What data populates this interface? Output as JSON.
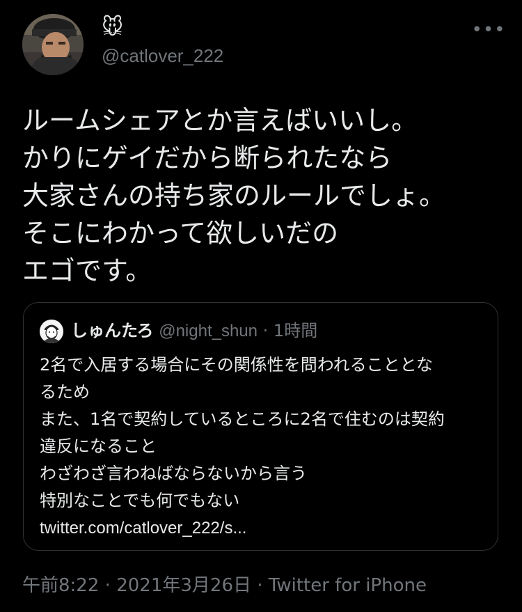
{
  "author": {
    "display_name": "🐭",
    "handle": "@catlover_222"
  },
  "more_label": "•••",
  "tweet": {
    "lines": [
      "ルームシェアとか言えばいいし。",
      "かりにゲイだから断られたなら",
      "大家さんの持ち家のルールでしょ。",
      "そこにわかって欲しいだの",
      "エゴです。"
    ]
  },
  "quote": {
    "name": "しゅんたろ",
    "handle": "@night_shun",
    "separator": "·",
    "time": "1時間",
    "lines": [
      "2名で入居する場合にその関係性を問われることとな",
      "るため",
      "また、1名で契約しているところに2名で住むのは契約",
      "違反になること",
      "わざわざ言わねばならないから言う",
      "特別なことでも何でもない",
      "twitter.com/catlover_222/s..."
    ]
  },
  "meta": {
    "time": "午前8:22",
    "separator": "·",
    "date": "2021年3月26日",
    "source": "Twitter for iPhone"
  },
  "colors": {
    "background": "#000000",
    "text": "#e7e9ea",
    "secondary": "#71767b",
    "border": "#2f3336"
  },
  "icons": {
    "more": "more-horizontal-icon",
    "avatar": "user-avatar",
    "quote_avatar": "quoted-user-avatar"
  }
}
